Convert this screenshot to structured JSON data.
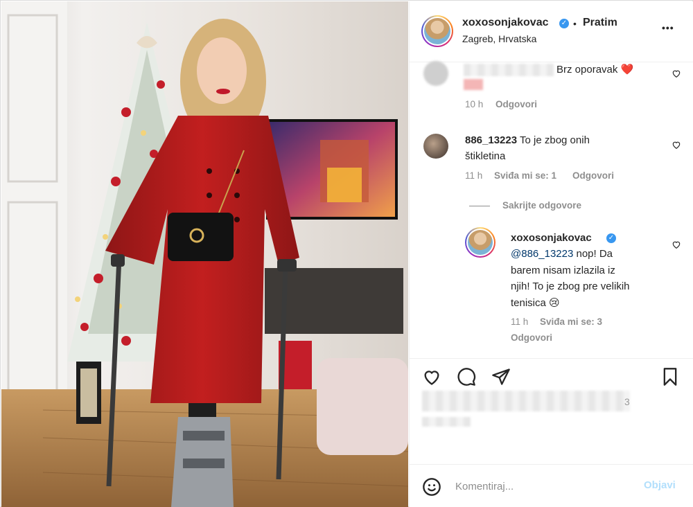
{
  "post": {
    "author": "xoxosonjakovac",
    "follow_label": "Pratim",
    "separator": "•",
    "location": "Zagreb, Hrvatska",
    "more_label": "•••"
  },
  "comments": [
    {
      "text": "Brz oporavak ❤️",
      "time": "10 h",
      "reply_label": "Odgovori"
    },
    {
      "username": "886_13223",
      "text_line1": "To je zbog onih",
      "text_line2": "štikletina",
      "time": "11 h",
      "likes_label": "Sviđa mi se: 1",
      "reply_label": "Odgovori"
    }
  ],
  "hide_replies_label": "Sakrijte odgovore",
  "reply": {
    "username": "xoxosonjakovac",
    "mention": "@886_13223",
    "text_line1_rest": " nop! Da",
    "text_line2": "barem nisam izlazila iz",
    "text_line3": "njih! To je zbog pre velikih",
    "text_line4": "tenisica 😢",
    "time": "11 h",
    "likes_label": "Sviđa mi se: 3",
    "reply_label": "Odgovori"
  },
  "likes_blur_digit": "3",
  "composer": {
    "placeholder": "Komentiraj...",
    "post_label": "Objavi"
  },
  "colors": {
    "verified": "#3897f0",
    "meta_text": "#8e8e8e",
    "post_button_disabled": "#b2dffc",
    "mention": "#00376b"
  },
  "icons": [
    "verified-icon",
    "heart-icon",
    "comment-icon",
    "share-icon",
    "bookmark-icon",
    "emoji-icon",
    "more-icon"
  ]
}
